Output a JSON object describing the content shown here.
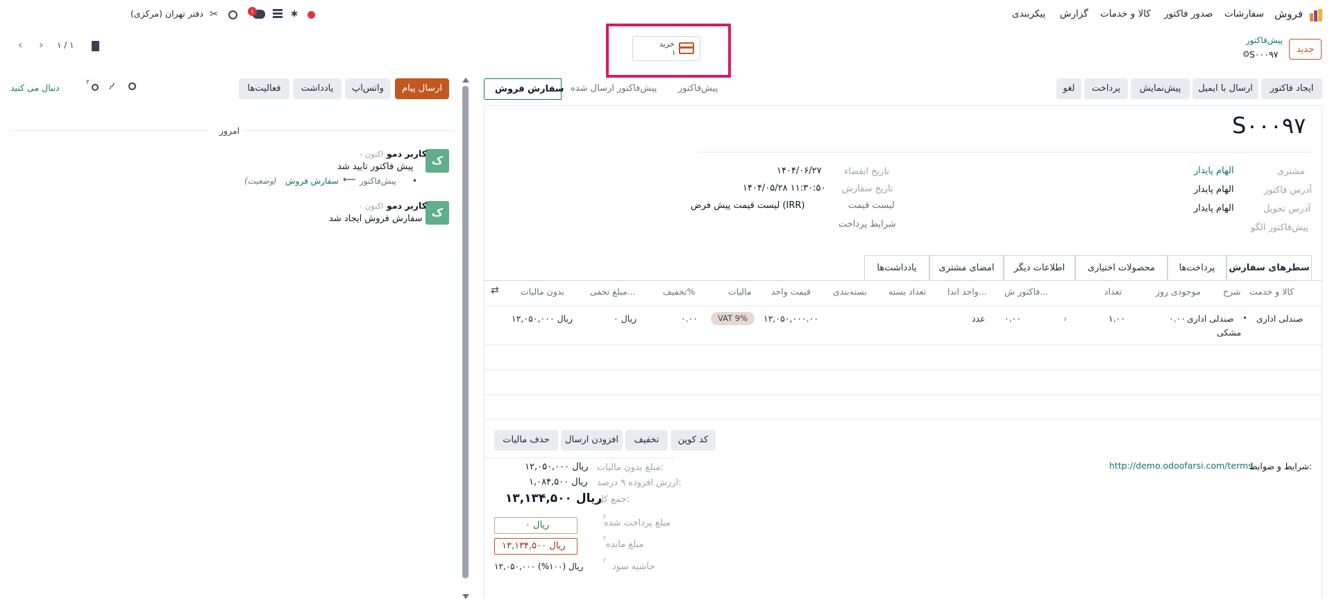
{
  "navbar": {
    "app_name": "فروش",
    "menu": [
      "سفارشات",
      "صدور فاکتور",
      "کالا و خدمات",
      "گزارش",
      "پیکربندی"
    ],
    "company": "دفتر تهران (مرکزی)",
    "chat_badge": "۱"
  },
  "control": {
    "new_label": "جدید",
    "breadcrumb_parent": "پیش‌فاکتور",
    "record_name": "S۰۰۰۹۷",
    "pager": "۱ / ۱",
    "smart_button": {
      "label": "خرید",
      "count": "۱"
    }
  },
  "actions": {
    "buttons": [
      "ایجاد فاکتور",
      "ارسال با ایمیل",
      "پیش‌نمایش",
      "پرداخت",
      "لغو"
    ],
    "stages": [
      "پیش‌فاکتور",
      "پیش‌فاکتور ارسال شده",
      "سفارش فروش"
    ]
  },
  "chatter_bar": {
    "send_message": "ارسال پیام",
    "whatsapp": "واتس‌اپ",
    "note": "یادداشت",
    "activities": "فعالیت‌ها",
    "followers_count": "۲",
    "following": "دنبال می کنید"
  },
  "form": {
    "title": "S۰۰۰۹۷",
    "left_fields": [
      {
        "label": "مشتری",
        "value": "الهام پایدار"
      },
      {
        "label": "آدرس فاکتور",
        "value": "الهام پایدار"
      },
      {
        "label": "آدرس تحویل",
        "value": "الهام پایدار"
      },
      {
        "label": "پیش‌فاکتور الگو",
        "value": ""
      }
    ],
    "right_fields": [
      {
        "label": "تاریخ انقضاء",
        "value": "۱۴۰۴/۰۶/۲۷"
      },
      {
        "label": "تاریخ سفارش",
        "value": "۱۴۰۴/۰۵/۲۸ ۱۱:۳۰:۵۰"
      },
      {
        "label": "لیست قیمت",
        "value": "لیست قیمت پیش فرض (IRR)"
      },
      {
        "label": "شرایط پرداخت",
        "value": ""
      }
    ],
    "tabs": [
      "سطرهای سفارش",
      "پرداخت‌ها",
      "محصولات اختیاری",
      "اطلاعات دیگر",
      "امضای مشتری",
      "یادداشت‌ها"
    ],
    "columns": [
      "کالا و خدمت",
      "شرح",
      "موجودی روز",
      "تعداد",
      "فاکتور ش...",
      "واحد اندا...",
      "تعداد بسته",
      "بسته‌بندی",
      "قیمت واحد",
      "مالیات",
      "تخفیف%",
      "مبلغ تخفی...",
      "بدون مالیات"
    ],
    "row": {
      "product": "صندلی اداری",
      "description_1": "صندلی اداری",
      "description_2": "مشکی",
      "stock": "۰.۰۰",
      "quantity": "۱.۰۰",
      "invoiced": "۰.۰۰",
      "uom": "عدد",
      "unit_price": "۱۲,۰۵۰,۰۰۰.۰۰",
      "tax": "VAT 9%",
      "discount_pct": "۰.۰۰",
      "discount_amount": "۰ ریال",
      "subtotal": "۱۲,۰۵۰,۰۰۰ ریال"
    },
    "footer_buttons": [
      "کد کوپن",
      "تخفیف",
      "افزودن ارسال",
      "حذف مالیات"
    ],
    "terms_label": "شرایط و ضوابط:",
    "terms_url": "http://demo.odoofarsi.com/terms",
    "totals": [
      {
        "label": "مبلغ بدون مالیات:",
        "value": "۱۲,۰۵۰,۰۰۰ ریال"
      },
      {
        "label": "ارزش افزوده ۹ درصد:",
        "value": "۱,۰۸۴,۵۰۰ ریال"
      },
      {
        "label": "جمع کل:",
        "value": "۱۳,۱۳۴,۵۰۰ ریال"
      }
    ],
    "paid": {
      "label": "مبلغ پرداخت شده",
      "value": "۰ ریال"
    },
    "remaining": {
      "label": "مبلغ مانده",
      "value": "۱۳,۱۳۴,۵۰۰ ریال"
    },
    "margin": {
      "label": "حاشیه سود",
      "value": "۱۲,۰۵۰,۰۰۰ ریال (۱۰۰%)"
    }
  },
  "chatter": {
    "today": "امروز",
    "messages": [
      {
        "avatar": "ک",
        "author": "کاربر دمو",
        "time": "- اکنون",
        "body": "پیش فاکتور تایید شد",
        "change_from": "پیش‌فاکتور",
        "change_to": "سفارش فروش",
        "change_field": "(وضعیت)"
      },
      {
        "avatar": "ک",
        "author": "کاربر دمو",
        "time": "- اکنون",
        "body": "سفارش فروش ایجاد شد"
      }
    ]
  },
  "colors": {
    "accent": "#c2571f",
    "link": "#0f766e",
    "highlight": "#d81b60"
  }
}
